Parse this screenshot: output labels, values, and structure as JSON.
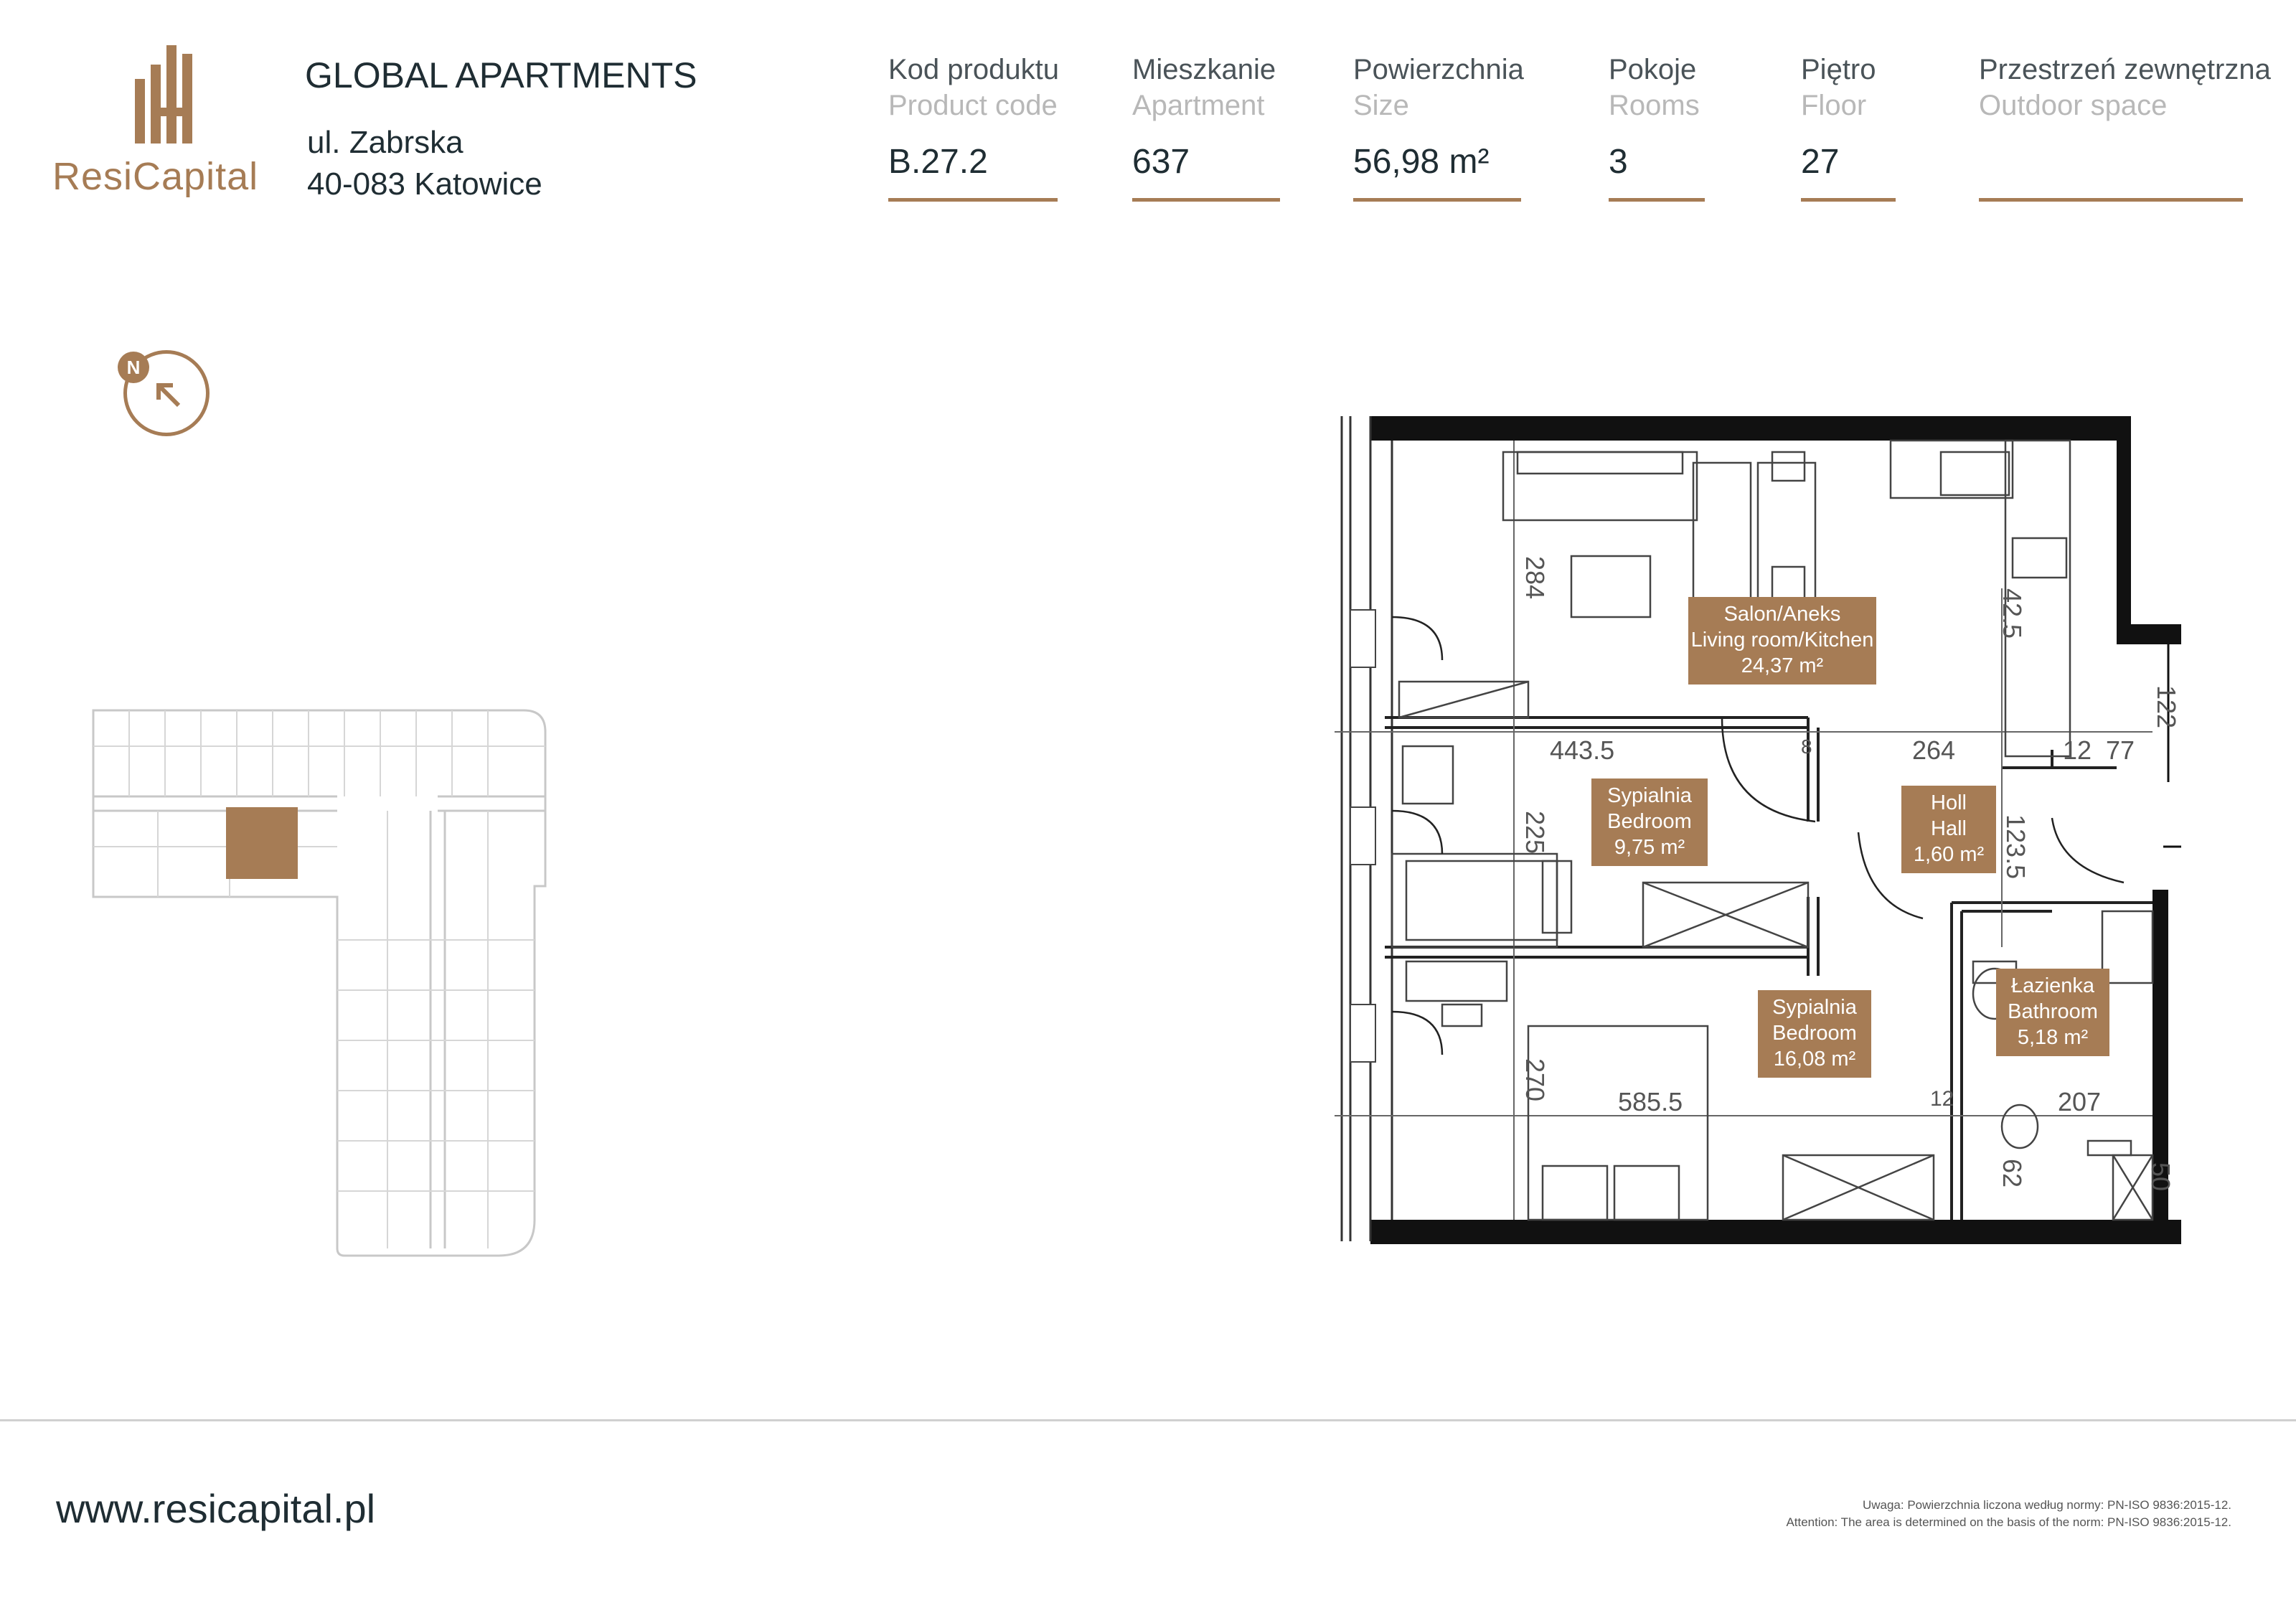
{
  "brand": {
    "name_part1": "Resi",
    "name_part2": "Capital"
  },
  "project": {
    "title": "GLOBAL APARTMENTS",
    "street": "ul. Zabrska",
    "city": "40-083 Katowice"
  },
  "columns": [
    {
      "label": "Kod produktu",
      "sub": "Product code",
      "value": "B.27.2"
    },
    {
      "label": "Mieszkanie",
      "sub": "Apartment",
      "value": "637"
    },
    {
      "label": "Powierzchnia",
      "sub": "Size",
      "value": "56,98 m²"
    },
    {
      "label": "Pokoje",
      "sub": "Rooms",
      "value": "3"
    },
    {
      "label": "Piętro",
      "sub": "Floor",
      "value": "27"
    },
    {
      "label": "Przestrzeń zewnętrzna",
      "sub": "Outdoor space",
      "value": ""
    }
  ],
  "compass": {
    "letter": "N"
  },
  "rooms": [
    {
      "pl": "Salon/Aneks",
      "en": "Living room/Kitchen",
      "area": "24,37 m²"
    },
    {
      "pl": "Sypialnia",
      "en": "Bedroom",
      "area": "9,75 m²"
    },
    {
      "pl": "Holl",
      "en": "Hall",
      "area": "1,60 m²"
    },
    {
      "pl": "Sypialnia",
      "en": "Bedroom",
      "area": "16,08 m²"
    },
    {
      "pl": "Łazienka",
      "en": "Bathroom",
      "area": "5,18 m²"
    }
  ],
  "dimensions": {
    "d1": "443.5",
    "d2": "264",
    "d3": "585.5",
    "d4": "207",
    "d5": "284",
    "d6": "225",
    "d7": "270",
    "d8": "42.5",
    "d9": "122",
    "d10": "77",
    "d11": "12",
    "d12": "123.5",
    "d13": "62",
    "d14": "50",
    "d15": "8",
    "d16": "12"
  },
  "footer": {
    "website": "www.resicapital.pl",
    "note_pl": "Uwaga: Powierzchnia liczona według normy: PN-ISO 9836:2015-12.",
    "note_en": "Attention: The area is determined on the basis of the norm: PN-ISO 9836:2015-12."
  },
  "colors": {
    "accent": "#a67c55",
    "text": "#1f2d33",
    "wall": "#111111"
  }
}
